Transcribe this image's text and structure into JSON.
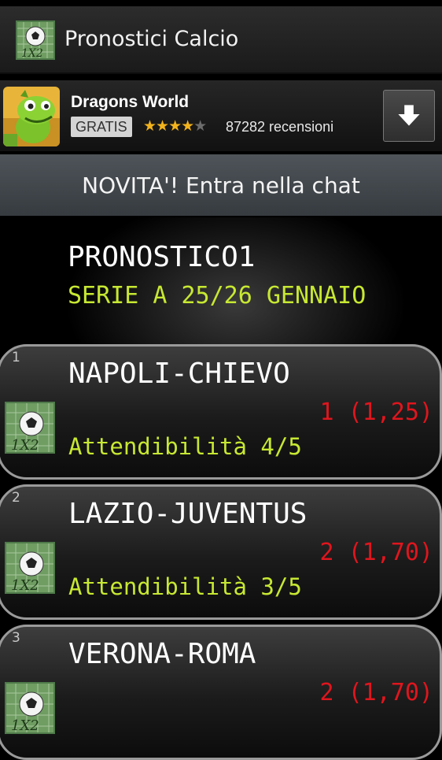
{
  "app": {
    "title": "Pronostici Calcio"
  },
  "ad": {
    "title": "Dragons World",
    "price": "GRATIS",
    "rating": 4,
    "rating_max": 5,
    "reviews": "87282 recensioni"
  },
  "chat": {
    "label": "NOVITA'!  Entra nella chat"
  },
  "header": {
    "title": "PRONOSTICO1",
    "subtitle": "SERIE A 25/26 GENNAIO"
  },
  "predictions": [
    {
      "index": "1",
      "match": "NAPOLI-CHIEVO",
      "odds": "1 (1,25)",
      "reliability": "Attendibilità 4/5"
    },
    {
      "index": "2",
      "match": "LAZIO-JUVENTUS",
      "odds": "2 (1,70)",
      "reliability": "Attendibilità 3/5"
    },
    {
      "index": "3",
      "match": "VERONA-ROMA",
      "odds": "2 (1,70)",
      "reliability": ""
    }
  ],
  "colors": {
    "accent": "#c7e832",
    "odds": "#e0151d",
    "star": "#f3b31c"
  }
}
